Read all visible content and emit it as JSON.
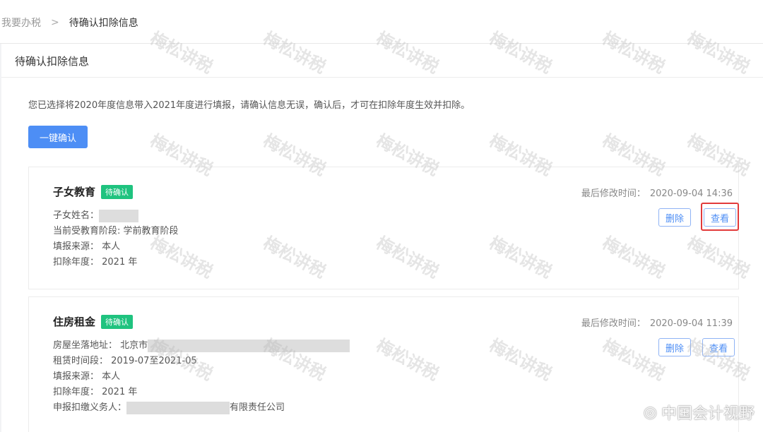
{
  "breadcrumb": {
    "parent": "我要办税",
    "separator": ">",
    "current": "待确认扣除信息"
  },
  "panel": {
    "title": "待确认扣除信息",
    "notice": "您已选择将2020年度信息带入2021年度进行填报，请确认信息无误，确认后，才可在扣除年度生效并扣除。",
    "confirm_all_label": "一键确认"
  },
  "cards": [
    {
      "name": "子女教育",
      "status": "待确认",
      "mtime_label": "最后修改时间：",
      "mtime": "2020-09-04 14:36",
      "delete_label": "删除",
      "view_label": "查看",
      "fields": {
        "child_name_label": "子女姓名：",
        "stage": "当前受教育阶段: 学前教育阶段",
        "source": "填报来源： 本人",
        "year": "扣除年度： 2021 年"
      }
    },
    {
      "name": "住房租金",
      "status": "待确认",
      "mtime_label": "最后修改时间：",
      "mtime": "2020-09-04 11:39",
      "delete_label": "删除",
      "view_label": "查看",
      "fields": {
        "address_label": "房屋坐落地址： 北京市",
        "period": "租赁时间段： 2019-07至2021-05",
        "source": "填报来源： 本人",
        "year": "扣除年度： 2021 年",
        "withholder_label": "申报扣缴义务人：",
        "withholder_suffix": "有限责任公司"
      }
    }
  ],
  "watermark": "梅松讲税",
  "brand": {
    "icon": "weibo-icon",
    "text": "中国会计视野"
  }
}
